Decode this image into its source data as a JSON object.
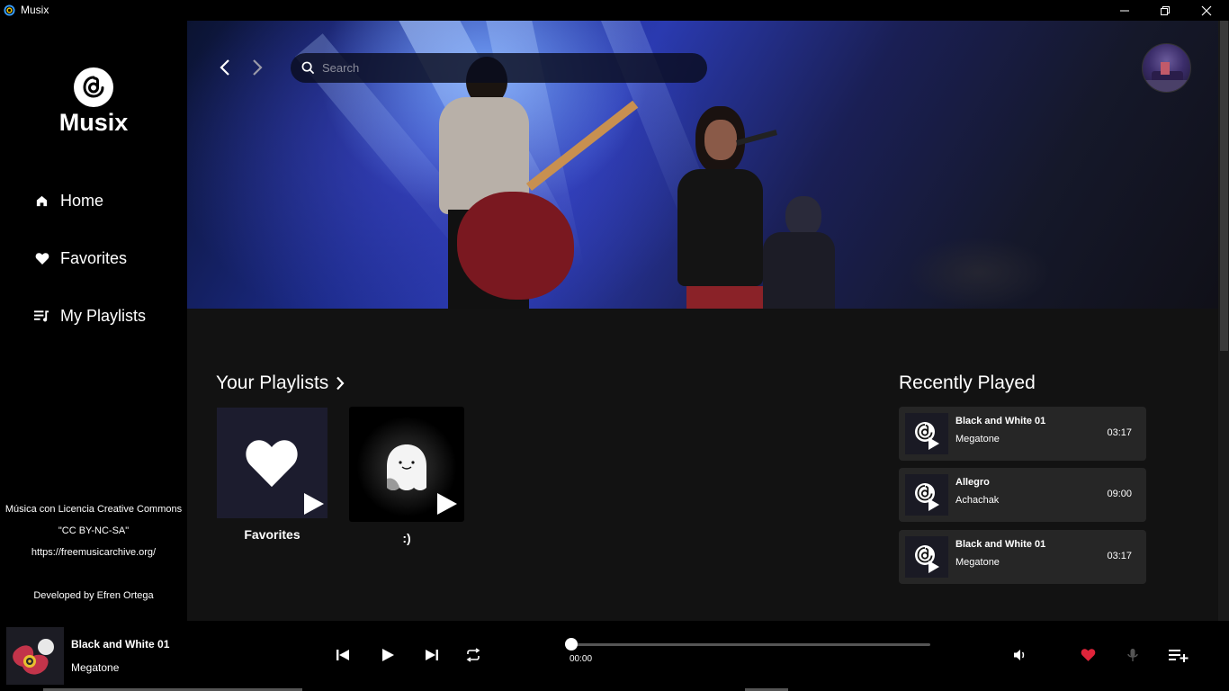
{
  "window": {
    "title": "Musix",
    "controls": [
      "minimize-icon",
      "restore-icon",
      "close-icon"
    ]
  },
  "sidebar": {
    "logo_text": "Musix",
    "items": [
      {
        "label": "Home",
        "icon": "home-icon"
      },
      {
        "label": "Favorites",
        "icon": "heart-icon"
      },
      {
        "label": "My Playlists",
        "icon": "playlist-icon"
      }
    ],
    "credits": {
      "line1": "Música con Licencia Creative Commons",
      "line2": "\"CC BY-NC-SA\"",
      "line3": "https://freemusicarchive.org/",
      "developer": "Developed by Efren Ortega"
    }
  },
  "header": {
    "search_placeholder": "Search"
  },
  "playlists": {
    "title": "Your Playlists",
    "items": [
      {
        "name": "Favorites"
      },
      {
        "name": ":)"
      }
    ]
  },
  "recently_played": {
    "title": "Recently Played",
    "items": [
      {
        "title": "Black and White 01",
        "artist": "Megatone",
        "duration": "03:17"
      },
      {
        "title": "Allegro",
        "artist": "Achachak",
        "duration": "09:00"
      },
      {
        "title": "Black and White 01",
        "artist": "Megatone",
        "duration": "03:17"
      }
    ]
  },
  "player": {
    "title": "Black and White 01",
    "artist": "Megatone",
    "current_time": "00:00",
    "progress": 0,
    "favorite": true,
    "colors": {
      "favorite": "#e0243a",
      "accent": "#ffffff"
    }
  }
}
